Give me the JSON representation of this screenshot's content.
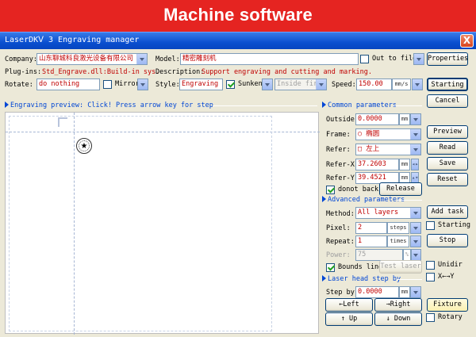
{
  "banner": {
    "title": "Machine software"
  },
  "window": {
    "title": "LaserDKⅤ 3 Engraving manager",
    "close": "X"
  },
  "form": {
    "company_label": "Company:",
    "company_value": "山东聊城科良激光设备有限公司",
    "model_label": "Model:",
    "model_value": "精密雕刻机",
    "out_to_file": "Out to file",
    "properties_btn": "Properties",
    "plugins_label": "Plug-ins:",
    "plugins_value": "Std_Engrave.dll:Build-in sys.",
    "description_label": "Description:",
    "description_value": "Support engraving and cutting and marking.",
    "rotate_label": "Rotate:",
    "rotate_value": "do nothing",
    "mirror": "Mirror",
    "style_label": "Style:",
    "style_value": "Engraving",
    "sunken": "Sunken",
    "inside_first": "Inside first",
    "speed_label": "Speed:",
    "speed_value": "150.00",
    "speed_unit": "mm/s",
    "starting_btn": "Starting",
    "cancel_btn": "Cancel"
  },
  "preview": {
    "header": "Engraving preview: Click! Press arrow key for step",
    "stamp_icon": "★"
  },
  "common": {
    "header": "Common parameters",
    "outside_label": "Outside:",
    "outside_value": "0.0000",
    "outside_unit": "mm",
    "frame_label": "Frame:",
    "frame_value": "○ 椭圆",
    "refer_label": "Refer:",
    "refer_value": "□ 左上",
    "referx_label": "Refer-X:",
    "referx_value": "37.2603",
    "referx_unit": "mm",
    "refery_label": "Refer-Y:",
    "refery_value": "39.4521",
    "refery_unit": "mm",
    "donot_back": "donot back",
    "release_btn": "Release",
    "preview_btn": "Preview",
    "read_btn": "Read",
    "save_btn": "Save",
    "reset_btn": "Reset"
  },
  "advanced": {
    "header": "Advanced parameters",
    "method_label": "Method:",
    "method_value": "All layers",
    "pixel_label": "Pixel:",
    "pixel_value": "2",
    "pixel_unit": "steps",
    "repeat_label": "Repeat:",
    "repeat_value": "1",
    "repeat_unit": "times",
    "power_label": "Power:",
    "power_value": "75",
    "power_unit": "%",
    "bounds_line": "Bounds line",
    "test_laser_btn": "Test laser",
    "add_task_btn": "Add task",
    "starting_chk": "Starting",
    "stop_btn": "Stop",
    "unidir_chk": "Unidir",
    "xy_chk": "X←→Y"
  },
  "laserhead": {
    "header": "Laser head step by",
    "stepby_label": "Step by:",
    "stepby_value": "0.0000",
    "stepby_unit": "mm",
    "left_btn": "←Left",
    "right_btn": "→Right",
    "up_btn": "↑ Up",
    "down_btn": "↓ Down",
    "fixture_btn": "Fixture",
    "rotary_chk": "Rotary"
  }
}
